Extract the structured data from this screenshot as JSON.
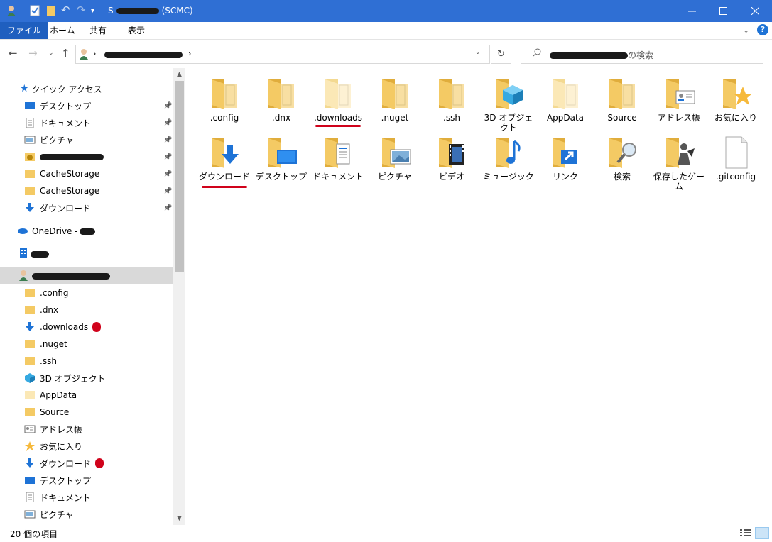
{
  "window": {
    "title_prefix": "S",
    "title_suffix": "(SCMC)"
  },
  "ribbon": {
    "tabs": [
      "ファイル",
      "ホーム",
      "共有",
      "表示"
    ]
  },
  "address": {
    "path_redacted": true,
    "search_suffix": "の検索"
  },
  "nav": {
    "quick_access": "クイック アクセス",
    "quick_items": [
      {
        "label": "デスクトップ",
        "icon": "desktop-icon",
        "pinned": true
      },
      {
        "label": "ドキュメント",
        "icon": "document-icon",
        "pinned": true
      },
      {
        "label": "ピクチャ",
        "icon": "picture-icon",
        "pinned": true
      },
      {
        "label": "",
        "icon": "warning-folder-icon",
        "pinned": true,
        "redacted": true
      },
      {
        "label": "CacheStorage",
        "icon": "folder-icon",
        "pinned": true
      },
      {
        "label": "CacheStorage",
        "icon": "folder-icon",
        "pinned": true
      },
      {
        "label": "ダウンロード",
        "icon": "download-icon",
        "pinned": true
      }
    ],
    "onedrive": "OneDrive - ",
    "user_items": [
      {
        "label": ".config",
        "icon": "folder-icon"
      },
      {
        "label": ".dnx",
        "icon": "folder-icon"
      },
      {
        "label": ".downloads",
        "icon": "download-icon",
        "marked": true
      },
      {
        "label": ".nuget",
        "icon": "folder-icon"
      },
      {
        "label": ".ssh",
        "icon": "folder-icon"
      },
      {
        "label": "3D オブジェクト",
        "icon": "3d-object-icon"
      },
      {
        "label": "AppData",
        "icon": "folder-light-icon"
      },
      {
        "label": "Source",
        "icon": "folder-icon"
      },
      {
        "label": "アドレス帳",
        "icon": "contacts-icon"
      },
      {
        "label": "お気に入り",
        "icon": "star-icon"
      },
      {
        "label": "ダウンロード",
        "icon": "download-icon",
        "marked": true
      },
      {
        "label": "デスクトップ",
        "icon": "desktop-icon"
      },
      {
        "label": "ドキュメント",
        "icon": "document-icon"
      },
      {
        "label": "ピクチャ",
        "icon": "picture-icon"
      }
    ]
  },
  "grid_items": [
    {
      "label": ".config",
      "icon": "folder-doc-icon"
    },
    {
      "label": ".dnx",
      "icon": "folder-doc-icon"
    },
    {
      "label": ".downloads",
      "icon": "folder-light-icon",
      "underlined": true
    },
    {
      "label": ".nuget",
      "icon": "folder-doc-icon"
    },
    {
      "label": ".ssh",
      "icon": "folder-doc-icon"
    },
    {
      "label": "3D オブジェクト",
      "icon": "folder-3d-icon"
    },
    {
      "label": "AppData",
      "icon": "folder-light-icon"
    },
    {
      "label": "Source",
      "icon": "folder-doc-icon"
    },
    {
      "label": "アドレス帳",
      "icon": "folder-contacts-icon"
    },
    {
      "label": "お気に入り",
      "icon": "folder-star-icon"
    },
    {
      "label": "ダウンロード",
      "icon": "folder-download-icon",
      "underlined": true
    },
    {
      "label": "デスクトップ",
      "icon": "folder-desktop-icon"
    },
    {
      "label": "ドキュメント",
      "icon": "folder-document-icon"
    },
    {
      "label": "ピクチャ",
      "icon": "folder-picture-icon"
    },
    {
      "label": "ビデオ",
      "icon": "folder-video-icon"
    },
    {
      "label": "ミュージック",
      "icon": "folder-music-icon"
    },
    {
      "label": "リンク",
      "icon": "folder-link-icon"
    },
    {
      "label": "検索",
      "icon": "folder-search-icon"
    },
    {
      "label": "保存したゲーム",
      "icon": "folder-game-icon"
    },
    {
      "label": ".gitconfig",
      "icon": "file-icon"
    }
  ],
  "status": {
    "item_count": "20 個の項目"
  },
  "colors": {
    "titlebar": "#2f6fd4",
    "folder": "#f4ca64",
    "folder_dark": "#e0ad3c",
    "accent_blue": "#1e73d6",
    "marker_red": "#d0021b"
  }
}
